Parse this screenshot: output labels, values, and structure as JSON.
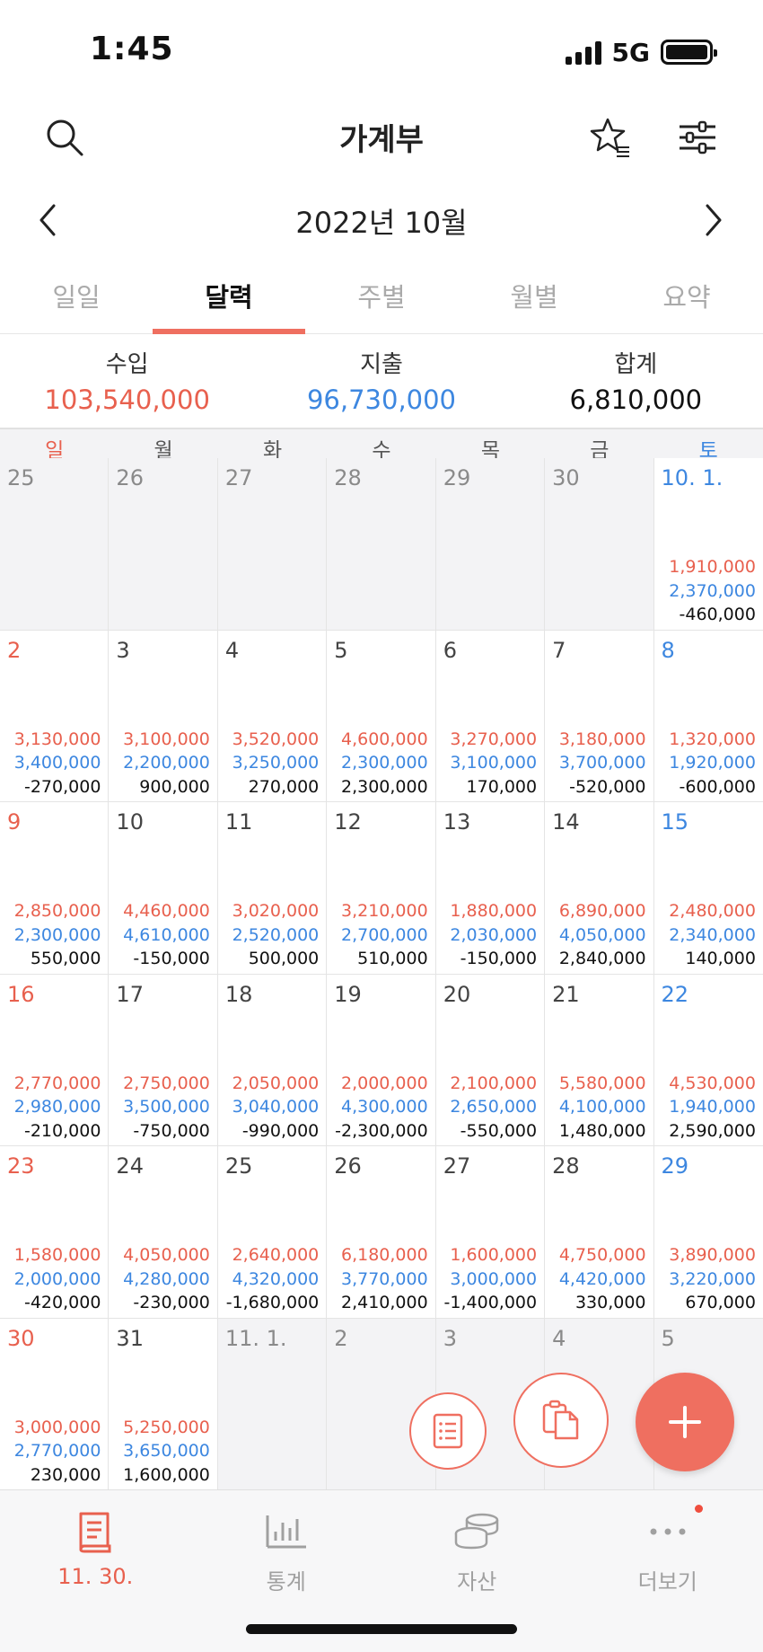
{
  "status": {
    "time": "1:45",
    "network": "5G"
  },
  "header": {
    "title": "가계부"
  },
  "month": {
    "label": "2022년 10월"
  },
  "tabs": [
    {
      "label": "일일",
      "active": false
    },
    {
      "label": "달력",
      "active": true
    },
    {
      "label": "주별",
      "active": false
    },
    {
      "label": "월별",
      "active": false
    },
    {
      "label": "요약",
      "active": false
    }
  ],
  "summary": {
    "income_label": "수입",
    "income_value": "103,540,000",
    "expense_label": "지출",
    "expense_value": "96,730,000",
    "total_label": "합계",
    "total_value": "6,810,000"
  },
  "weekdays": [
    "일",
    "월",
    "화",
    "수",
    "목",
    "금",
    "토"
  ],
  "calendar": [
    [
      {
        "day": "25",
        "other": true
      },
      {
        "day": "26",
        "other": true
      },
      {
        "day": "27",
        "other": true
      },
      {
        "day": "28",
        "other": true
      },
      {
        "day": "29",
        "other": true
      },
      {
        "day": "30",
        "other": true
      },
      {
        "day": "10. 1.",
        "income": "1,910,000",
        "expense": "2,370,000",
        "total": "-460,000"
      }
    ],
    [
      {
        "day": "2",
        "income": "3,130,000",
        "expense": "3,400,000",
        "total": "-270,000"
      },
      {
        "day": "3",
        "income": "3,100,000",
        "expense": "2,200,000",
        "total": "900,000"
      },
      {
        "day": "4",
        "income": "3,520,000",
        "expense": "3,250,000",
        "total": "270,000"
      },
      {
        "day": "5",
        "income": "4,600,000",
        "expense": "2,300,000",
        "total": "2,300,000"
      },
      {
        "day": "6",
        "income": "3,270,000",
        "expense": "3,100,000",
        "total": "170,000"
      },
      {
        "day": "7",
        "income": "3,180,000",
        "expense": "3,700,000",
        "total": "-520,000"
      },
      {
        "day": "8",
        "income": "1,320,000",
        "expense": "1,920,000",
        "total": "-600,000"
      }
    ],
    [
      {
        "day": "9",
        "income": "2,850,000",
        "expense": "2,300,000",
        "total": "550,000"
      },
      {
        "day": "10",
        "income": "4,460,000",
        "expense": "4,610,000",
        "total": "-150,000"
      },
      {
        "day": "11",
        "income": "3,020,000",
        "expense": "2,520,000",
        "total": "500,000"
      },
      {
        "day": "12",
        "income": "3,210,000",
        "expense": "2,700,000",
        "total": "510,000"
      },
      {
        "day": "13",
        "income": "1,880,000",
        "expense": "2,030,000",
        "total": "-150,000"
      },
      {
        "day": "14",
        "income": "6,890,000",
        "expense": "4,050,000",
        "total": "2,840,000"
      },
      {
        "day": "15",
        "income": "2,480,000",
        "expense": "2,340,000",
        "total": "140,000"
      }
    ],
    [
      {
        "day": "16",
        "income": "2,770,000",
        "expense": "2,980,000",
        "total": "-210,000"
      },
      {
        "day": "17",
        "income": "2,750,000",
        "expense": "3,500,000",
        "total": "-750,000"
      },
      {
        "day": "18",
        "income": "2,050,000",
        "expense": "3,040,000",
        "total": "-990,000"
      },
      {
        "day": "19",
        "income": "2,000,000",
        "expense": "4,300,000",
        "total": "-2,300,000"
      },
      {
        "day": "20",
        "income": "2,100,000",
        "expense": "2,650,000",
        "total": "-550,000"
      },
      {
        "day": "21",
        "income": "5,580,000",
        "expense": "4,100,000",
        "total": "1,480,000"
      },
      {
        "day": "22",
        "income": "4,530,000",
        "expense": "1,940,000",
        "total": "2,590,000"
      }
    ],
    [
      {
        "day": "23",
        "income": "1,580,000",
        "expense": "2,000,000",
        "total": "-420,000"
      },
      {
        "day": "24",
        "income": "4,050,000",
        "expense": "4,280,000",
        "total": "-230,000"
      },
      {
        "day": "25",
        "income": "2,640,000",
        "expense": "4,320,000",
        "total": "-1,680,000"
      },
      {
        "day": "26",
        "income": "6,180,000",
        "expense": "3,770,000",
        "total": "2,410,000"
      },
      {
        "day": "27",
        "income": "1,600,000",
        "expense": "3,000,000",
        "total": "-1,400,000"
      },
      {
        "day": "28",
        "income": "4,750,000",
        "expense": "4,420,000",
        "total": "330,000"
      },
      {
        "day": "29",
        "income": "3,890,000",
        "expense": "3,220,000",
        "total": "670,000"
      }
    ],
    [
      {
        "day": "30",
        "income": "3,000,000",
        "expense": "2,770,000",
        "total": "230,000"
      },
      {
        "day": "31",
        "income": "5,250,000",
        "expense": "3,650,000",
        "total": "1,600,000"
      },
      {
        "day": "11. 1.",
        "other": true
      },
      {
        "day": "2",
        "other": true
      },
      {
        "day": "3",
        "other": true
      },
      {
        "day": "4",
        "other": true
      },
      {
        "day": "5",
        "other": true
      }
    ]
  ],
  "bottom_nav": [
    {
      "label": "11. 30.",
      "icon": "book-icon",
      "active": true
    },
    {
      "label": "통계",
      "icon": "chart-icon",
      "active": false
    },
    {
      "label": "자산",
      "icon": "coins-icon",
      "active": false
    },
    {
      "label": "더보기",
      "icon": "more-icon",
      "active": false
    }
  ],
  "colors": {
    "accent": "#ef6f60",
    "income": "#e8604e",
    "expense": "#3d87e0"
  }
}
